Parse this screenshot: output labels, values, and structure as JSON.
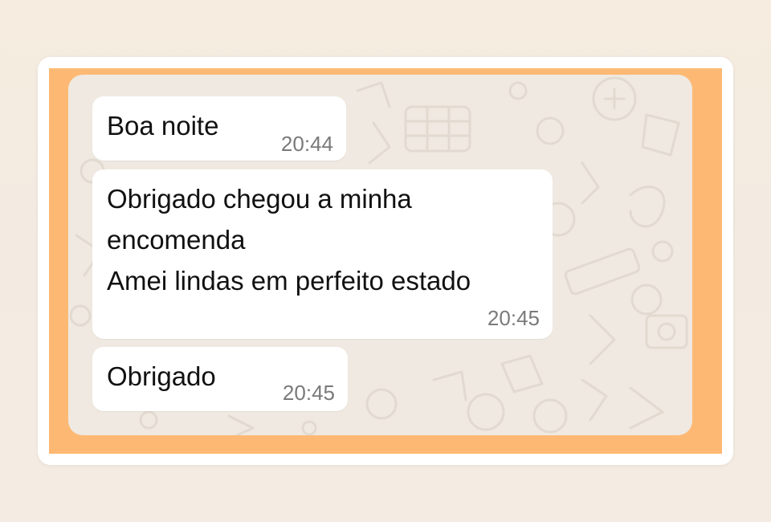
{
  "messages": [
    {
      "lines": [
        "Boa noite"
      ],
      "time": "20:44"
    },
    {
      "lines": [
        "Obrigado chegou a minha",
        "encomenda",
        "Amei lindas em perfeito estado"
      ],
      "time": "20:45"
    },
    {
      "lines": [
        "Obrigado"
      ],
      "time": "20:45"
    }
  ],
  "colors": {
    "frame": "#fdb974",
    "chat_background": "#efe9e1",
    "bubble": "#ffffff",
    "timestamp": "#7a7a7a"
  }
}
